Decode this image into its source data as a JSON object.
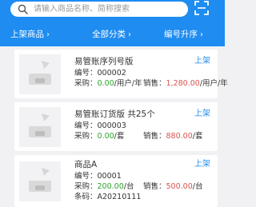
{
  "search": {
    "placeholder": "请输入商品名称、简称搜索"
  },
  "filters": [
    {
      "label": "上架商品"
    },
    {
      "label": "全部分类"
    },
    {
      "label": "编号升序"
    }
  ],
  "products": [
    {
      "name": "易管账序列号版",
      "status": "上架",
      "code_label": "编号：",
      "code": "000002",
      "purchase_label": "采购：",
      "purchase": "0.00",
      "purchase_unit": "/用户/年",
      "sale_label": "销售：",
      "sale": "1,280.00",
      "sale_unit": "/用户/年"
    },
    {
      "name": "易管账订货版 共25个",
      "status": "上架",
      "code_label": "编号：",
      "code": "000003",
      "purchase_label": "采购：",
      "purchase": "0.00",
      "purchase_unit": "/套",
      "sale_label": "销售：",
      "sale": "880.00",
      "sale_unit": "/套"
    },
    {
      "name": "商品A",
      "status": "上架",
      "code_label": "编号：",
      "code": "00001",
      "purchase_label": "采购：",
      "purchase": "200.00",
      "purchase_unit": "/台",
      "sale_label": "销售：",
      "sale": "500.00",
      "sale_unit": "/台",
      "barcode_label": "条码：",
      "barcode": "A20210111"
    }
  ],
  "colors": {
    "primary": "#1e8cf0",
    "purchase": "#2ca52c",
    "sale": "#d9534f"
  }
}
